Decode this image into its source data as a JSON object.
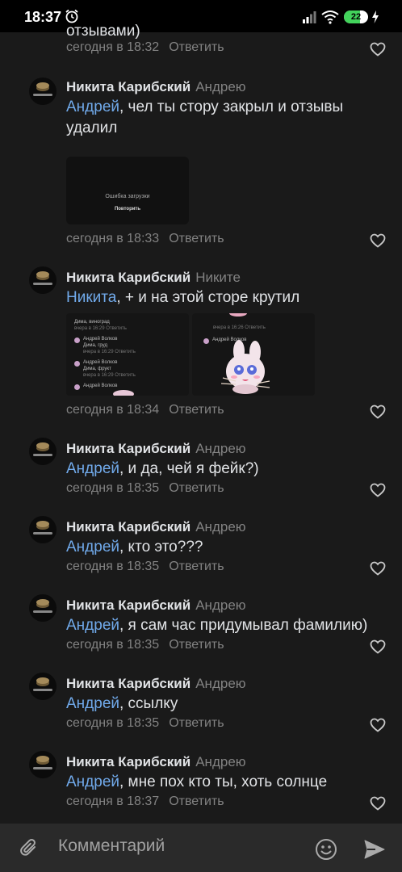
{
  "status_bar": {
    "time": "18:37",
    "battery": "22",
    "icons": [
      "alarm-icon",
      "signal-icon",
      "wifi-icon",
      "battery-icon",
      "charging-icon"
    ]
  },
  "colors": {
    "background": "#1a1a1a",
    "mention": "#71aaeb",
    "muted": "#828282"
  },
  "top_partial": {
    "text_fragment": "отзывами)",
    "time": "сегодня в 18:32",
    "reply": "Ответить"
  },
  "comments": [
    {
      "author": "Никита Карибский",
      "to": "Андрею",
      "mention": "Андрей",
      "text": ", чел ты стору закрыл и отзывы удалил",
      "attachment": {
        "error": "Ошибка загрузки",
        "retry": "Повторить"
      },
      "time": "сегодня в 18:33",
      "reply": "Ответить"
    },
    {
      "author": "Никита Карибский",
      "to": "Никите",
      "mention": "Никита",
      "text": ", + и на этой сторе крутил",
      "screenshots": {
        "left": {
          "line1_mention": "Дима",
          "line1_text": ", виноград",
          "line1_time": "вчера в 16:29",
          "line1_reply": "Ответить",
          "name1": "Андрей Волков",
          "line2_mention": "Дима",
          "line2_text": ", груд",
          "line2_time": "вчера в 16:29",
          "line2_reply": "Ответить",
          "name2": "Андрей Волков",
          "line3_mention": "Дима",
          "line3_text": ", фрукт",
          "line3_time": "вчера в 16:29",
          "line3_reply": "Ответить",
          "name3": "Андрей Волков"
        },
        "right": {
          "line1_time": "вчера в 16:26",
          "line1_reply": "Ответить",
          "name1": "Андрей Волков"
        }
      },
      "time": "сегодня в 18:34",
      "reply": "Ответить"
    },
    {
      "author": "Никита Карибский",
      "to": "Андрею",
      "mention": "Андрей",
      "text": ", и да, чей я фейк?)",
      "time": "сегодня в 18:35",
      "reply": "Ответить"
    },
    {
      "author": "Никита Карибский",
      "to": "Андрею",
      "mention": "Андрей",
      "text": ", кто это???",
      "time": "сегодня в 18:35",
      "reply": "Ответить"
    },
    {
      "author": "Никита Карибский",
      "to": "Андрею",
      "mention": "Андрей",
      "text": ", я сам час придумывал фамилию)",
      "time": "сегодня в 18:35",
      "reply": "Ответить"
    },
    {
      "author": "Никита Карибский",
      "to": "Андрею",
      "mention": "Андрей",
      "text": ", ссылку",
      "time": "сегодня в 18:35",
      "reply": "Ответить"
    },
    {
      "author": "Никита Карибский",
      "to": "Андрею",
      "mention": "Андрей",
      "text": ", мне пох кто ты, хоть солнце",
      "time": "сегодня в 18:37",
      "reply": "Ответить"
    }
  ],
  "input_bar": {
    "placeholder": "Комментарий",
    "icons": [
      "attach-icon",
      "emoji-icon",
      "send-icon"
    ]
  }
}
